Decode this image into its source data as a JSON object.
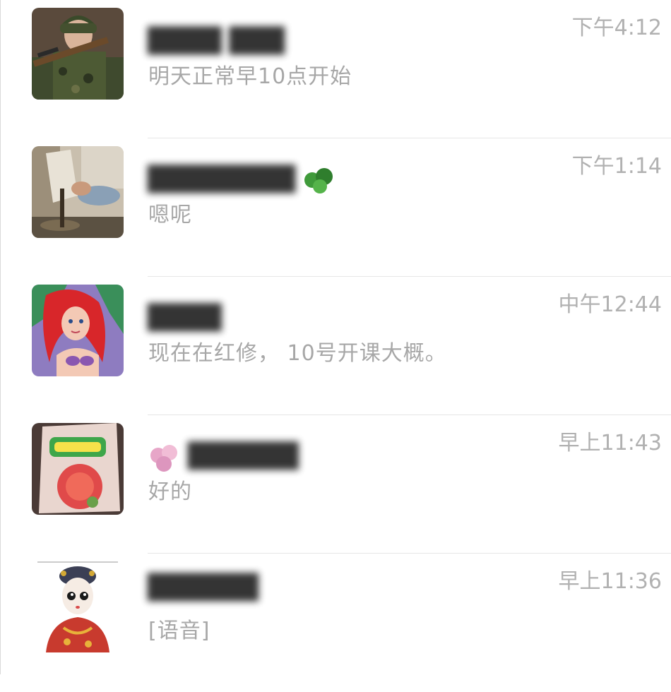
{
  "chats": [
    {
      "avatar_icon": "soldier-photo-avatar",
      "name": "████ ███",
      "time": "下午4:12",
      "preview": "明天正常早10点开始"
    },
    {
      "avatar_icon": "hands-photo-avatar",
      "name": "████████",
      "time": "下午1:14",
      "preview": "嗯呢"
    },
    {
      "avatar_icon": "mermaid-cartoon-avatar",
      "name": "████",
      "time": "中午12:44",
      "preview": "现在在红修， 10号开课大概。"
    },
    {
      "avatar_icon": "snack-package-avatar",
      "name": "██████",
      "time": "早上11:43",
      "preview": "好的"
    },
    {
      "avatar_icon": "ancient-lady-cartoon-avatar",
      "name": "██████",
      "time": "早上11:36",
      "preview": "[语音]"
    }
  ]
}
